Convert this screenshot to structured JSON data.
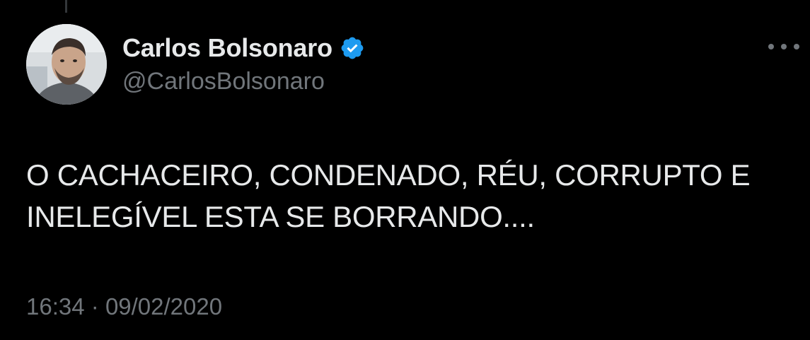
{
  "author": {
    "display_name": "Carlos Bolsonaro",
    "handle": "@CarlosBolsonaro",
    "verified": true
  },
  "tweet": {
    "text": "O CACHACEIRO, CONDENADO, RÉU, CORRUPTO E\nINELEGÍVEL ESTA SE BORRANDO....",
    "time": "16:34",
    "separator": "·",
    "date": "09/02/2020"
  },
  "icons": {
    "verified": "verified-badge-icon",
    "more": "more-options-icon"
  },
  "colors": {
    "background": "#000000",
    "primary_text": "#e7e9ea",
    "secondary_text": "#71767b",
    "verified_blue": "#1d9bf0"
  }
}
